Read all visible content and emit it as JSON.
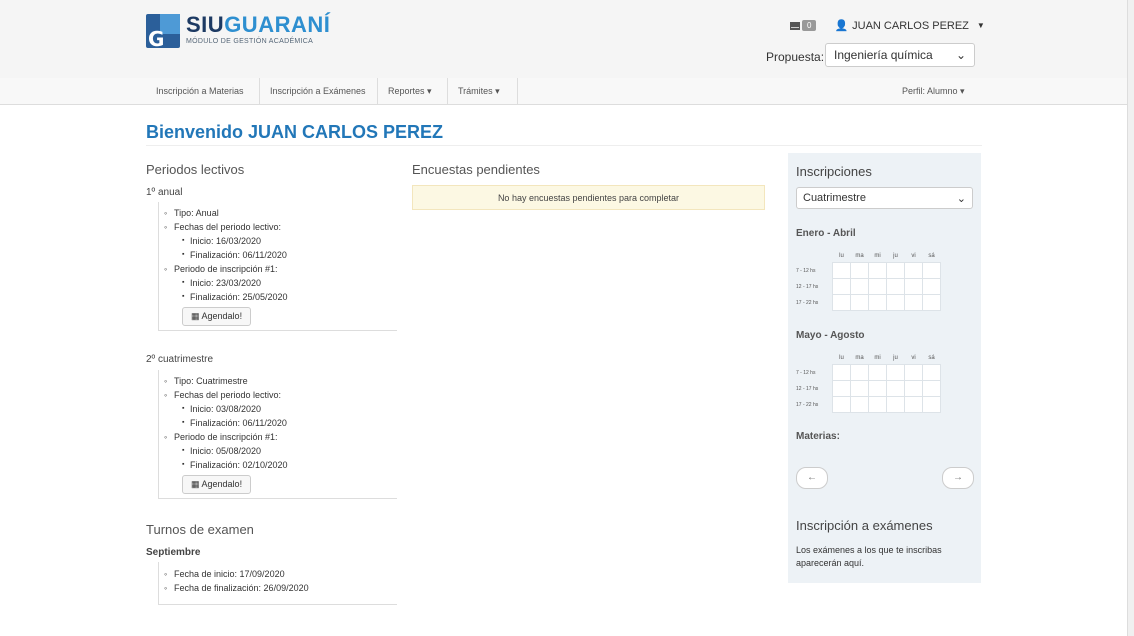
{
  "header": {
    "brand_siu": "SIU",
    "brand_guarani": "GUARANÍ",
    "brand_sub": "MÓDULO DE GESTIÓN ACADÉMICA",
    "mail_count": "0",
    "user_name": "JUAN CARLOS PEREZ",
    "propuesta_label": "Propuesta:",
    "propuesta_value": "Ingeniería química"
  },
  "nav": {
    "items": [
      "Inscripción a Materias",
      "Inscripción a Exámenes",
      "Reportes ▾",
      "Trámites ▾"
    ],
    "profile": "Perfil: Alumno ▾"
  },
  "welcome": "Bienvenido JUAN CARLOS PEREZ",
  "periodos": {
    "title": "Periodos lectivos",
    "p1": {
      "name": "1º anual",
      "tipo": "Tipo: Anual",
      "fechas": "Fechas del periodo lectivo:",
      "inicio": "Inicio: 16/03/2020",
      "fin": "Finalización: 06/11/2020",
      "insc": "Periodo de inscripción #1:",
      "insc_inicio": "Inicio: 23/03/2020",
      "insc_fin": "Finalización: 25/05/2020",
      "btn": "Agendalo!"
    },
    "p2": {
      "name": "2º cuatrimestre",
      "tipo": "Tipo: Cuatrimestre",
      "fechas": "Fechas del periodo lectivo:",
      "inicio": "Inicio: 03/08/2020",
      "fin": "Finalización: 06/11/2020",
      "insc": "Periodo de inscripción #1:",
      "insc_inicio": "Inicio: 05/08/2020",
      "insc_fin": "Finalización: 02/10/2020",
      "btn": "Agendalo!"
    }
  },
  "turnos": {
    "title": "Turnos de examen",
    "name": "Septiembre",
    "inicio": "Fecha de inicio: 17/09/2020",
    "fin": "Fecha de finalización: 26/09/2020"
  },
  "encuestas": {
    "title": "Encuestas pendientes",
    "notice": "No hay encuestas pendientes para completar"
  },
  "inscripciones": {
    "title": "Inscripciones",
    "select": "Cuatrimestre",
    "period1": "Enero - Abril",
    "period2": "Mayo - Agosto",
    "days": [
      "lu",
      "ma",
      "mi",
      "ju",
      "vi",
      "sá"
    ],
    "slots": [
      "7 - 12 hs",
      "12 - 17 hs",
      "17 - 22 hs"
    ],
    "materias": "Materias:",
    "prev": "←",
    "next": "→",
    "examenes_title": "Inscripción a exámenes",
    "examenes_text": "Los exámenes a los que te inscribas aparecerán aquí."
  },
  "icons": [
    "mail-icon",
    "user-icon",
    "calendar-icon",
    "arrow-left-icon",
    "arrow-right-icon"
  ]
}
